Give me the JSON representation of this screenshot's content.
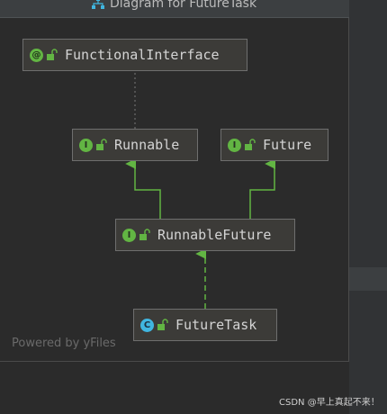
{
  "window": {
    "title": "Diagram for FutureTask",
    "title_icon": "hierarchy-diagram-icon"
  },
  "nodes": {
    "functional_interface": {
      "label": "FunctionalInterface",
      "badge": "@",
      "kind": "annotation"
    },
    "runnable": {
      "label": "Runnable",
      "badge": "I",
      "kind": "interface"
    },
    "future": {
      "label": "Future",
      "badge": "I",
      "kind": "interface"
    },
    "runnable_future": {
      "label": "RunnableFuture",
      "badge": "I",
      "kind": "interface"
    },
    "future_task": {
      "label": "FutureTask",
      "badge": "C",
      "kind": "class"
    }
  },
  "edges": [
    {
      "from": "runnable",
      "to": "functional_interface",
      "style": "dotted"
    },
    {
      "from": "runnable_future",
      "to": "runnable",
      "style": "solid-extends"
    },
    {
      "from": "runnable_future",
      "to": "future",
      "style": "solid-extends"
    },
    {
      "from": "future_task",
      "to": "runnable_future",
      "style": "dashed-implements"
    }
  ],
  "footer": {
    "powered_by": "Powered by yFiles"
  },
  "watermark": "CSDN @早上真起不来！",
  "colors": {
    "interface_badge": "#62b543",
    "class_badge": "#40b6e0",
    "edge": "#62b543",
    "node_fill": "#3c3b38",
    "node_border": "#6e6e6e"
  }
}
